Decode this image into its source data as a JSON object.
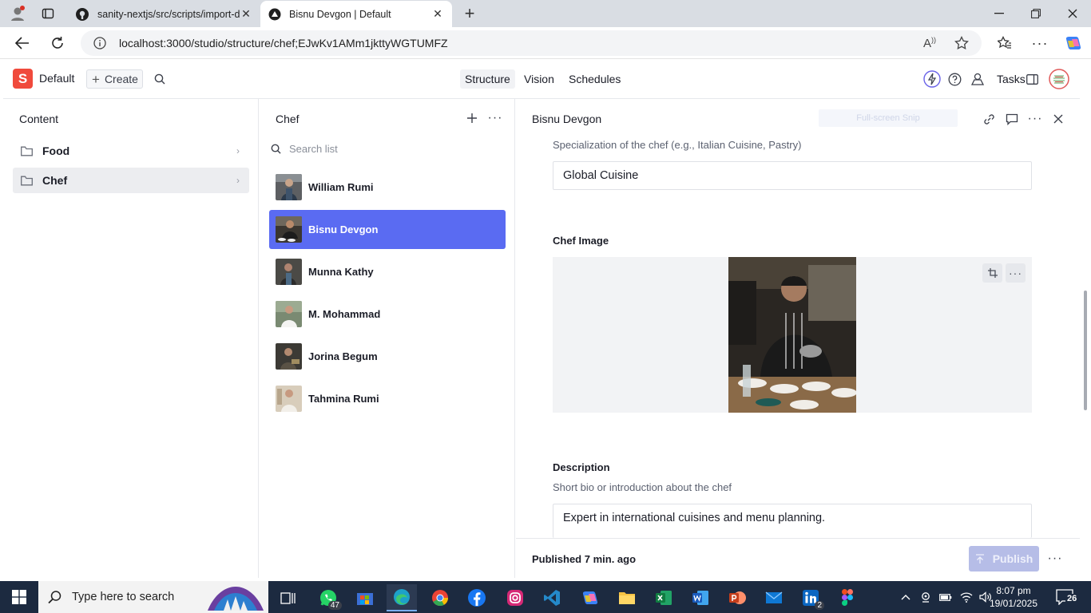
{
  "browser": {
    "tabs": [
      {
        "title": "sanity-nextjs/src/scripts/import-d"
      },
      {
        "title": "Bisnu Devgon | Default"
      }
    ],
    "url": "localhost:3000/studio/structure/chef;EJwKv1AMm1jkttyWGTUMFZ"
  },
  "studio": {
    "logo_letter": "S",
    "workspace": "Default",
    "create_label": "Create",
    "nav": [
      "Structure",
      "Vision",
      "Schedules"
    ],
    "tasks_label": "Tasks"
  },
  "content_pane": {
    "title": "Content",
    "items": [
      "Food",
      "Chef"
    ]
  },
  "chef_pane": {
    "title": "Chef",
    "search_placeholder": "Search list",
    "chefs": [
      "William Rumi",
      "Bisnu Devgon",
      "Munna Kathy",
      "M. Mohammad",
      "Jorina Begum",
      "Tahmina Rumi"
    ],
    "selected": "Bisnu Devgon"
  },
  "document": {
    "title": "Bisnu Devgon",
    "snip_ghost": "Full-screen Snip",
    "specialization_desc": "Specialization of the chef (e.g., Italian Cuisine, Pastry)",
    "specialization_value": "Global Cuisine",
    "image_label": "Chef Image",
    "description_label": "Description",
    "description_desc": "Short bio or introduction about the chef",
    "description_value": "Expert in international cuisines and menu planning.",
    "status_prefix": "Published",
    "status_time": "7 min. ago",
    "publish_label": "Publish"
  },
  "taskbar": {
    "search_placeholder": "Type here to search",
    "whatsapp_badge": "47",
    "linkedin_badge": "2",
    "time": "8:07 pm",
    "date": "19/01/2025",
    "notifications": "26"
  },
  "colors": {
    "accent": "#5a6bf2",
    "brand": "#f04a3c",
    "publish_disabled": "#b6bde7",
    "taskbar": "#1c2a40"
  }
}
